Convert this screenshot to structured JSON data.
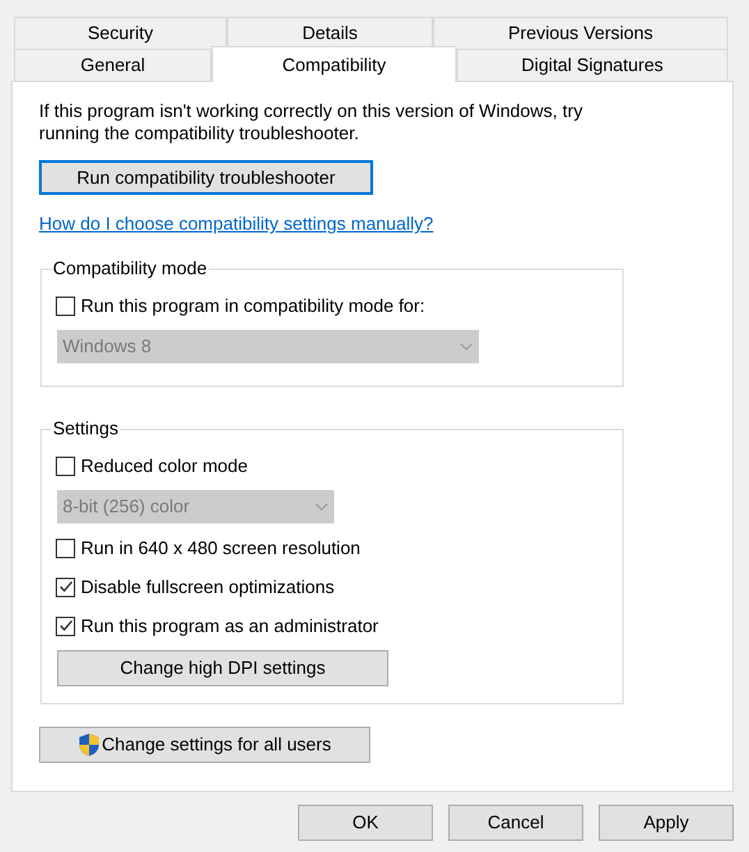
{
  "tab_rows": [
    {
      "tabs": [
        {
          "label": "Security",
          "selected": false
        },
        {
          "label": "Details",
          "selected": false
        },
        {
          "label": "Previous Versions",
          "selected": false
        }
      ]
    },
    {
      "tabs": [
        {
          "label": "General",
          "selected": false
        },
        {
          "label": "Compatibility",
          "selected": true
        },
        {
          "label": "Digital Signatures",
          "selected": false
        }
      ]
    }
  ],
  "intro": "If this program isn't working correctly on this version of Windows, try running the compatibility troubleshooter.",
  "troubleshooter_button": {
    "label": "Run compatibility troubleshooter",
    "focused": true
  },
  "help_link": "How do I choose compatibility settings manually?",
  "groups": [
    {
      "title": "Compatibility mode",
      "items": [
        {
          "kind": "checkbox",
          "label": "Run this program in compatibility mode for:",
          "checked": false
        },
        {
          "kind": "select",
          "value": "Windows 8",
          "disabled": true
        }
      ]
    },
    {
      "title": "Settings",
      "items": [
        {
          "kind": "checkbox",
          "label": "Reduced color mode",
          "checked": false
        },
        {
          "kind": "select",
          "value": "8-bit (256) color",
          "disabled": true
        },
        {
          "kind": "checkbox",
          "label": "Run in 640 x 480 screen resolution",
          "checked": false
        },
        {
          "kind": "checkbox",
          "label": "Disable fullscreen optimizations",
          "checked": true
        },
        {
          "kind": "checkbox",
          "label": "Run this program as an administrator",
          "checked": true
        },
        {
          "kind": "button",
          "label": "Change high DPI settings"
        }
      ]
    }
  ],
  "all_users_button": {
    "label": "Change settings for all users"
  },
  "dialog_buttons": [
    {
      "label": "OK"
    },
    {
      "label": "Cancel"
    },
    {
      "label": "Apply"
    }
  ]
}
